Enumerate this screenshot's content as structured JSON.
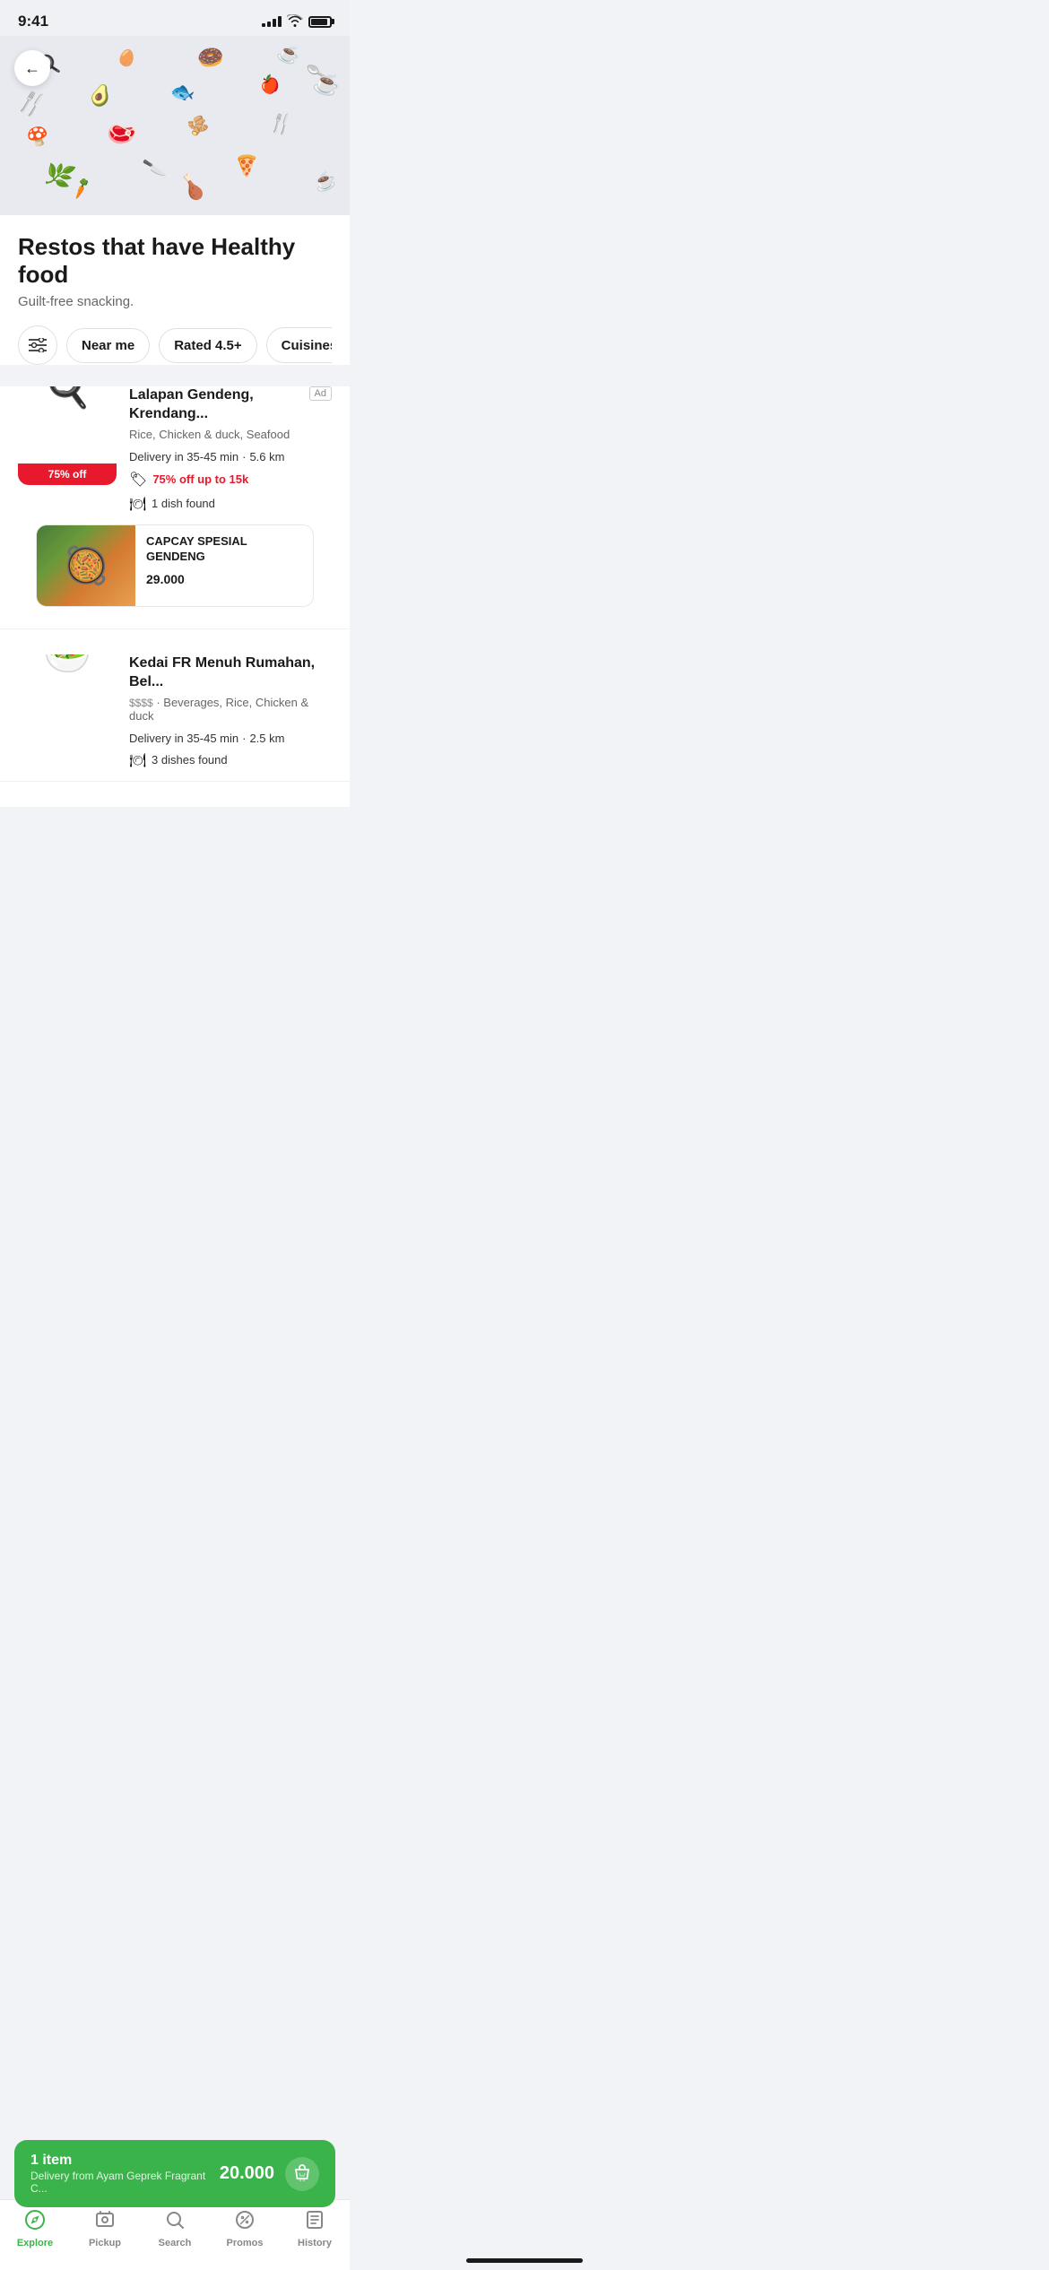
{
  "statusBar": {
    "time": "9:41",
    "signalBars": [
      3,
      5,
      7,
      9,
      11
    ],
    "battery": "full"
  },
  "header": {
    "backLabel": "←"
  },
  "page": {
    "title": "Restos that have Healthy food",
    "subtitle": "Guilt-free snacking."
  },
  "filters": {
    "filterIcon": "⚙",
    "nearMe": "Near me",
    "rated": "Rated 4.5+",
    "cuisines": "Cuisines",
    "chevron": "▾"
  },
  "restaurants": [
    {
      "name": "Lalapan Gendeng, Krendang...",
      "isAd": true,
      "adLabel": "Ad",
      "cuisine": "Rice, Chicken & duck, Seafood",
      "deliveryTime": "Delivery in 35-45 min",
      "distance": "5.6 km",
      "discountBadge": "75% off",
      "promoText": "75% off up to 15k",
      "dishFoundText": "1 dish found",
      "dish": {
        "name": "CAPCAY SPESIAL GENDENG",
        "price": "29.000"
      }
    },
    {
      "name": "Kedai FR Menuh Rumahan, Bel...",
      "isAd": false,
      "adLabel": "",
      "priceRange": "$$$$",
      "cuisine": "Beverages, Rice, Chicken & duck",
      "deliveryTime": "Delivery in 35-45 min",
      "distance": "2.5 km",
      "dishFoundText": "3 dishes found"
    }
  ],
  "cartBar": {
    "itemCount": "1 item",
    "restaurantName": "Delivery from Ayam Geprek Fragrant C...",
    "price": "20.000",
    "bagIcon": "🛒"
  },
  "bottomNav": {
    "items": [
      {
        "id": "explore",
        "icon": "🧭",
        "label": "Explore",
        "active": true
      },
      {
        "id": "pickup",
        "icon": "📷",
        "label": "Pickup",
        "active": false
      },
      {
        "id": "search",
        "icon": "🔍",
        "label": "Search",
        "active": false
      },
      {
        "id": "promos",
        "icon": "🏷",
        "label": "Promos",
        "active": false
      },
      {
        "id": "history",
        "icon": "📋",
        "label": "History",
        "active": false
      }
    ]
  }
}
